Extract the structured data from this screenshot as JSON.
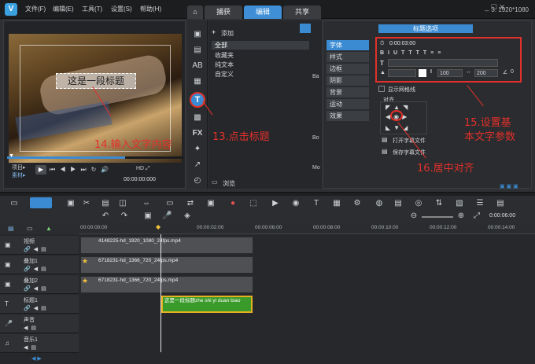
{
  "menu": [
    "文件(F)",
    "编辑(E)",
    "工具(T)",
    "设置(S)",
    "帮助(H)"
  ],
  "tabs": [
    "捕获",
    "编辑",
    "共享"
  ],
  "resolution": "3. 1920*1080",
  "preview": {
    "title_text": "这是一段标题",
    "mode_project": "项目▸",
    "mode_clip": "素材▸",
    "timecode": "00:00:00:000"
  },
  "library": {
    "add_label": "添加",
    "items": [
      "全部",
      "收藏夹",
      "纯文本",
      "自定义"
    ],
    "browse": "浏览",
    "side_letters": [
      "Ba",
      "Bo",
      "Mo"
    ]
  },
  "options": {
    "header": "标题选项",
    "tabs": [
      "字体",
      "样式",
      "边框",
      "阴影",
      "背景",
      "运动",
      "效果"
    ],
    "duration": "0:00:03:00",
    "font_size": "100",
    "line_spacing": "200",
    "rotation": "0",
    "show_grid": "显示网格线",
    "align_label": "对齐",
    "open_subtitle": "打开字幕文件",
    "save_subtitle": "保存字幕文件"
  },
  "annotations": {
    "step13": "13.点击标题",
    "step14": "14.输入文字内容",
    "step15_line1": "15.设置基",
    "step15_line2": "本文字参数",
    "step16": "16.居中对齐"
  },
  "timeline": {
    "zoom_time": "0:00:06:00",
    "ruler": [
      "00:00:00:00",
      "00:00:02:00",
      "00:00:04:00",
      "00:00:06:00",
      "00:00:08:00",
      "00:00:10:00",
      "00:00:12:00",
      "00:00:14:00"
    ],
    "tracks": [
      "视频",
      "叠加1",
      "叠加2",
      "标题1",
      "声音",
      "音乐1"
    ],
    "clips": [
      "4148225-hd_1920_1080_24fps.mp4",
      "6718231-hd_1366_720_24fps.mp4",
      "6718231-hd_1366_720_24fps.mp4"
    ],
    "title_clip": "这是一段标题zhe shi yi duan biao"
  }
}
